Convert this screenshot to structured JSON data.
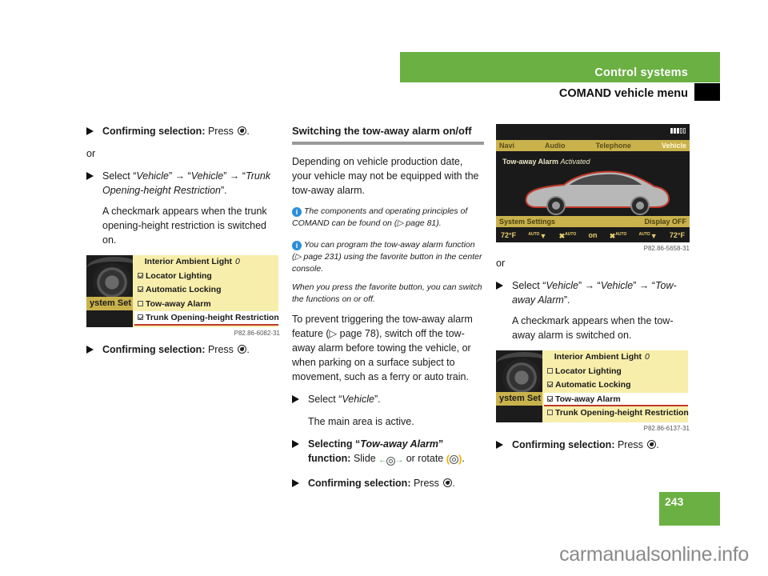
{
  "header": {
    "section": "Control systems",
    "subsection": "COMAND vehicle menu"
  },
  "page_number": "243",
  "watermark": "carmanualsonline.info",
  "colors": {
    "brand_green": "#6ab043",
    "menu_yellow": "#f8eeab",
    "highlight_red": "#c0392b",
    "info_blue": "#2a8fd8"
  },
  "col1": {
    "step1": {
      "bold": "Confirming selection:",
      "text": " Press",
      "icon": "press-button-icon",
      "end": "."
    },
    "or": "or",
    "step2": {
      "prefix": "Select “",
      "p1": "Vehicle",
      "mid1": "” → “",
      "p2": "Vehicle",
      "mid2": "” → “",
      "p3": "Trunk Opening-height Restriction",
      "end": "”."
    },
    "step2_note": "A checkmark appears when the trunk opening-height restriction is switched on.",
    "menu": {
      "left_label": "ystem Set",
      "header": "Interior Ambient Light",
      "header_value": "0",
      "items": [
        {
          "label": "Locator Lighting",
          "checked": true,
          "selected": false
        },
        {
          "label": "Automatic Locking",
          "checked": true,
          "selected": false
        },
        {
          "label": "Tow-away Alarm",
          "checked": false,
          "selected": false
        },
        {
          "label": "Trunk Opening-height Restriction",
          "checked": true,
          "selected": true
        }
      ],
      "caption": "P82.86-6082-31"
    },
    "step3": {
      "bold": "Confirming selection:",
      "text": " Press",
      "end": "."
    }
  },
  "col2": {
    "heading": "Switching the tow-away alarm on/off",
    "intro": "Depending on vehicle production date, your vehicle may not be equipped with the tow-away alarm.",
    "note1": "The components and operating principles of COMAND can be found on (▷ page 81).",
    "note2": "You can program the tow-away alarm function (▷ page 231) using the favorite button in the center console.",
    "note3": "When you press the favorite button, you can switch the functions on or off.",
    "para": "To prevent triggering the tow-away alarm feature (▷ page 78), switch off the tow-away alarm before towing the vehicle, or when parking on a surface subject to movement, such as a ferry or auto train.",
    "step1": {
      "prefix": "Select “",
      "italic": "Vehicle",
      "end": "”."
    },
    "step1_note": "The main area is active.",
    "step2": {
      "bold1": "Selecting “",
      "bold_italic": "Tow-away Alarm",
      "bold2": "” function:",
      "text1": " Slide ",
      "text2": " or rotate ",
      "end": "."
    },
    "step3": {
      "bold": "Confirming selection:",
      "text": " Press",
      "end": "."
    }
  },
  "col3": {
    "comand": {
      "tabs": [
        "Navi",
        "Audio",
        "Telephone",
        "Vehicle"
      ],
      "active_tab": "Vehicle",
      "title": "Tow-away Alarm",
      "status": "Activated",
      "bottom_left": "System Settings",
      "bottom_right": "Display OFF",
      "climate": [
        "72°F",
        "AUTO",
        "AUTO",
        "on",
        "AUTO",
        "AUTO",
        "72°F"
      ],
      "caption": "P82.86-5658-31"
    },
    "or": "or",
    "step1": {
      "prefix": "Select “",
      "p1": "Vehicle",
      "mid1": "” → “",
      "p2": "Vehicle",
      "mid2": "” → “",
      "p3": "Tow-away Alarm",
      "end": "”."
    },
    "step1_note": "A checkmark appears when the tow-away alarm is switched on.",
    "menu": {
      "left_label": "ystem Set",
      "header": "Interior Ambient Light",
      "header_value": "0",
      "items": [
        {
          "label": "Locator Lighting",
          "checked": false,
          "selected": false
        },
        {
          "label": "Automatic Locking",
          "checked": true,
          "selected": false
        },
        {
          "label": "Tow-away Alarm",
          "checked": true,
          "selected": true
        },
        {
          "label": "Trunk Opening-height Restriction",
          "checked": false,
          "selected": false
        }
      ],
      "caption": "P82.86-6137-31"
    },
    "step2": {
      "bold": "Confirming selection:",
      "text": " Press",
      "end": "."
    }
  }
}
